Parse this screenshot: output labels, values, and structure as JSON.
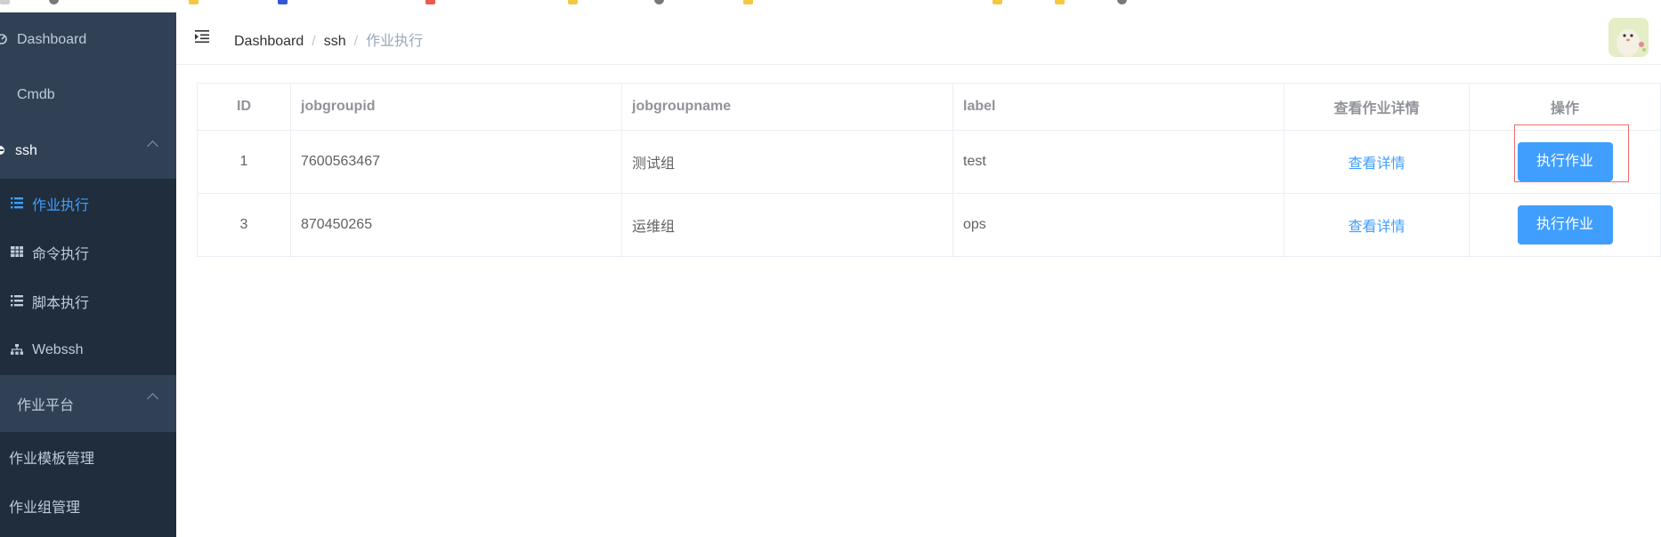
{
  "colors": {
    "sidebar_bg": "#304156",
    "submenu_bg": "#1f2d3d",
    "accent": "#409eff",
    "highlight": "#f56c6c"
  },
  "header": {
    "breadcrumb": [
      "Dashboard",
      "ssh",
      "作业执行"
    ]
  },
  "sidebar": {
    "items": [
      {
        "label": "Dashboard",
        "icon": "dashboard-icon"
      },
      {
        "label": "Cmdb",
        "icon": "cmdb-icon"
      },
      {
        "label": "ssh",
        "icon": "ssh-icon",
        "expanded": true
      },
      {
        "label": "作业执行",
        "icon": "list-icon",
        "active": true
      },
      {
        "label": "命令执行",
        "icon": "table-icon"
      },
      {
        "label": "脚本执行",
        "icon": "list-icon"
      },
      {
        "label": "Webssh",
        "icon": "sitemap-icon"
      },
      {
        "label": "作业平台",
        "icon": "platform-icon",
        "expanded": true
      },
      {
        "label": "作业模板管理"
      },
      {
        "label": "作业组管理"
      }
    ]
  },
  "table": {
    "headers": [
      "ID",
      "jobgroupid",
      "jobgroupname",
      "label",
      "查看作业详情",
      "操作"
    ],
    "rows": [
      {
        "id": "1",
        "jobgroupid": "7600563467",
        "jobgroupname": "测试组",
        "label": "test",
        "detail": "查看详情",
        "action": "执行作业"
      },
      {
        "id": "3",
        "jobgroupid": "870450265",
        "jobgroupname": "运维组",
        "label": "ops",
        "detail": "查看详情",
        "action": "执行作业"
      }
    ]
  }
}
